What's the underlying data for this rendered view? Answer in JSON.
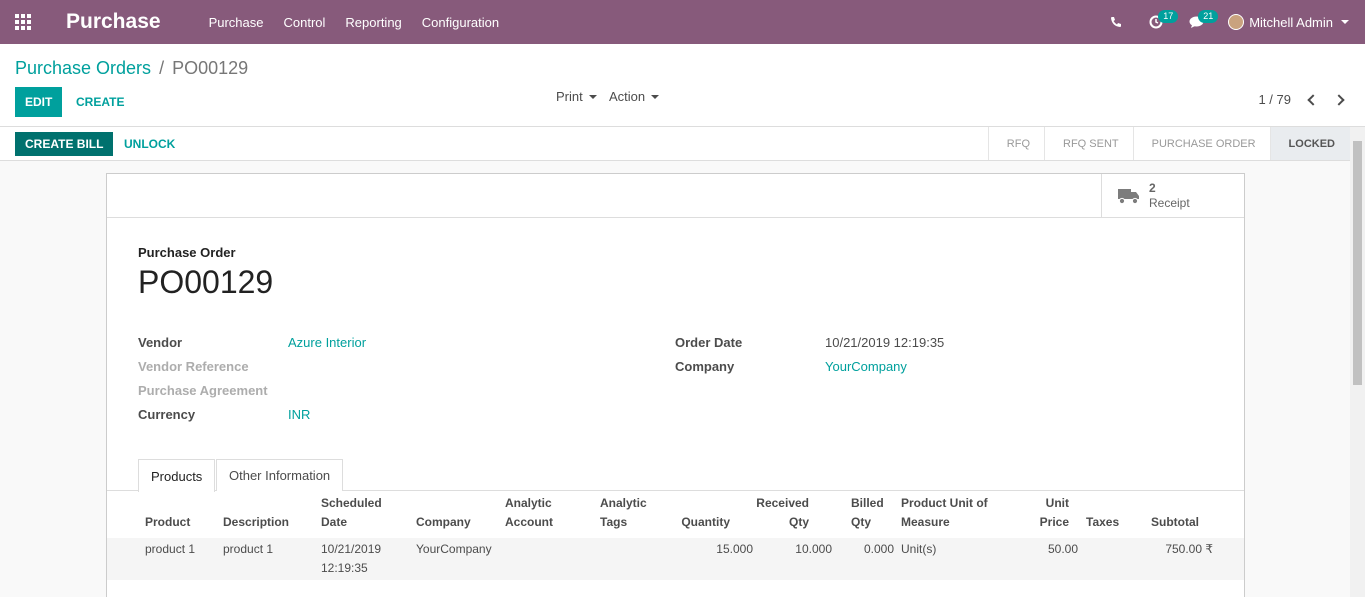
{
  "navbar": {
    "app_name": "Purchase",
    "menu": [
      "Purchase",
      "Control",
      "Reporting",
      "Configuration"
    ],
    "activity_count": "17",
    "message_count": "21",
    "user_name": "Mitchell Admin"
  },
  "breadcrumb": {
    "parent": "Purchase Orders",
    "separator": "/",
    "current": "PO00129"
  },
  "toolbar": {
    "edit": "EDIT",
    "create": "CREATE",
    "print": "Print",
    "action": "Action",
    "pager": "1 / 79"
  },
  "statusbar": {
    "create_bill": "CREATE BILL",
    "unlock": "UNLOCK",
    "stages": [
      "RFQ",
      "RFQ SENT",
      "PURCHASE ORDER",
      "LOCKED"
    ],
    "active_stage": "LOCKED"
  },
  "smart_button": {
    "count": "2",
    "label": "Receipt"
  },
  "form": {
    "subtitle": "Purchase Order",
    "title": "PO00129",
    "vendor_label": "Vendor",
    "vendor": "Azure Interior",
    "vendor_ref_label": "Vendor Reference",
    "agreement_label": "Purchase Agreement",
    "currency_label": "Currency",
    "currency": "INR",
    "order_date_label": "Order Date",
    "order_date": "10/21/2019 12:19:35",
    "company_label": "Company",
    "company": "YourCompany"
  },
  "tabs": [
    "Products",
    "Other Information"
  ],
  "table": {
    "headers": {
      "product": "Product",
      "description": "Description",
      "scheduled_1": "Scheduled",
      "scheduled_2": "Date",
      "company": "Company",
      "analytic_acc_1": "Analytic",
      "analytic_acc_2": "Account",
      "analytic_tags_1": "Analytic",
      "analytic_tags_2": "Tags",
      "quantity": "Quantity",
      "received_1": "Received",
      "received_2": "Qty",
      "billed_1": "Billed",
      "billed_2": "Qty",
      "uom_1": "Product Unit of",
      "uom_2": "Measure",
      "unit_price_1": "Unit",
      "unit_price_2": "Price",
      "taxes": "Taxes",
      "subtotal": "Subtotal"
    },
    "row": {
      "product": "product 1",
      "description": "product 1",
      "date_1": "10/21/2019",
      "date_2": "12:19:35",
      "company": "YourCompany",
      "quantity": "15.000",
      "received": "10.000",
      "billed": "0.000",
      "uom": "Unit(s)",
      "unit_price": "50.00",
      "subtotal": "750.00 ₹"
    }
  }
}
